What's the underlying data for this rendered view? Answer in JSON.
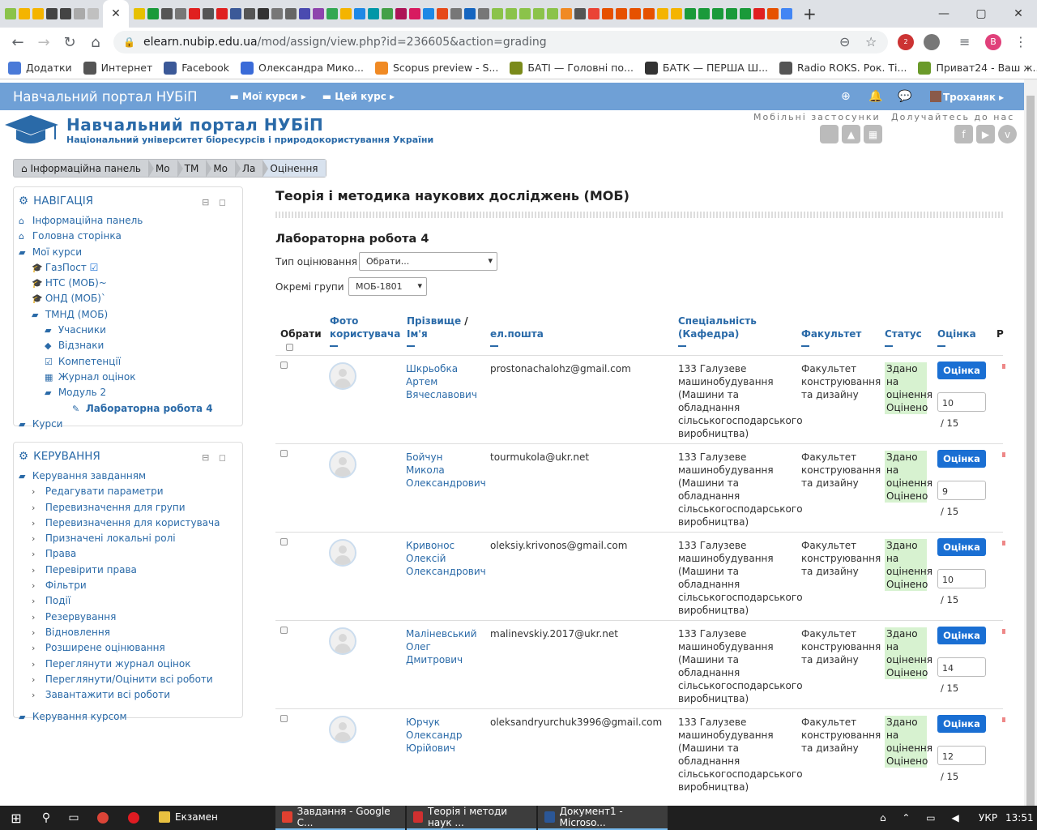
{
  "browser": {
    "active_tab_close": "✕",
    "new_tab": "+",
    "window_controls": {
      "min": "—",
      "max": "▢",
      "close": "✕"
    },
    "url_host": "elearn.nubip.edu.ua",
    "url_path": "/mod/assign/view.php?id=236605&action=grading",
    "profile_initial": "B",
    "ext_badge": "2"
  },
  "bookmarks": [
    {
      "label": "Додатки",
      "color": "#4a7ad8"
    },
    {
      "label": "Интернет",
      "color": "#555"
    },
    {
      "label": "Facebook",
      "color": "#3b5998"
    },
    {
      "label": "Олександра Мико...",
      "color": "#3a6bd8"
    },
    {
      "label": "Scopus preview - S...",
      "color": "#f08a24"
    },
    {
      "label": "БАТІ — Головні по...",
      "color": "#7a8a1a"
    },
    {
      "label": "БАТК — ПЕРША Ш...",
      "color": "#333"
    },
    {
      "label": "Radio ROKS. Рок. Ті...",
      "color": "#555"
    },
    {
      "label": "Приват24 - Ваш ж...",
      "color": "#6a9a2a"
    }
  ],
  "site": {
    "brand": "Навчальний портал НУБіП",
    "menu_my_courses": "Мої курси",
    "menu_this_course": "Цей курс",
    "user": "Троханяк",
    "header_title": "Навчальний портал НУБіП",
    "header_subtitle": "Національний університет біоресурсів і природокористування України",
    "mobile_apps": "Мобільні застосунки",
    "join_us": "Долучайтесь до нас"
  },
  "breadcrumb": [
    "Інформаційна панель",
    "Мо",
    "ТМ",
    "Мо",
    "Ла",
    "Оцінення"
  ],
  "nav_block": {
    "title": "НАВІГАЦІЯ",
    "items": [
      {
        "label": "Інформаційна панель",
        "icon": "⌂",
        "indent": 0
      },
      {
        "label": "Головна сторінка",
        "icon": "⌂",
        "indent": 0
      },
      {
        "label": "Мої курси",
        "icon": "▰",
        "indent": 0
      },
      {
        "label": "ГазПост",
        "icon": "🎓",
        "indent": 1
      },
      {
        "label": "НТС (МОБ)~",
        "icon": "🎓",
        "indent": 1
      },
      {
        "label": "ОНД (МОБ)`",
        "icon": "🎓",
        "indent": 1
      },
      {
        "label": "ТМНД (МОБ)",
        "icon": "▰",
        "indent": 1
      },
      {
        "label": "Учасники",
        "icon": "▰",
        "indent": 2
      },
      {
        "label": "Відзнаки",
        "icon": "◆",
        "indent": 2
      },
      {
        "label": "Компетенції",
        "icon": "☑",
        "indent": 2
      },
      {
        "label": "Журнал оцінок",
        "icon": "▦",
        "indent": 2
      },
      {
        "label": "Модуль 2",
        "icon": "▰",
        "indent": 2
      },
      {
        "label": "Лабораторна робота 4",
        "icon": "✎",
        "indent": 3,
        "current": true
      },
      {
        "label": "Курси",
        "icon": "▰",
        "indent": 0
      }
    ]
  },
  "admin_block": {
    "title": "КЕРУВАННЯ",
    "items": [
      {
        "label": "Керування завданням",
        "icon": "▰",
        "indent": 0
      },
      {
        "label": "Редагувати параметри",
        "icon": "›",
        "indent": 1
      },
      {
        "label": "Перевизначення для групи",
        "icon": "›",
        "indent": 1
      },
      {
        "label": "Перевизначення для користувача",
        "icon": "›",
        "indent": 1
      },
      {
        "label": "Призначені локальні ролі",
        "icon": "›",
        "indent": 1
      },
      {
        "label": "Права",
        "icon": "›",
        "indent": 1
      },
      {
        "label": "Перевірити права",
        "icon": "›",
        "indent": 1
      },
      {
        "label": "Фільтри",
        "icon": "›",
        "indent": 1
      },
      {
        "label": "Події",
        "icon": "›",
        "indent": 1
      },
      {
        "label": "Резервування",
        "icon": "›",
        "indent": 1
      },
      {
        "label": "Відновлення",
        "icon": "›",
        "indent": 1
      },
      {
        "label": "Розширене оцінювання",
        "icon": "›",
        "indent": 1
      },
      {
        "label": "Переглянути журнал оцінок",
        "icon": "›",
        "indent": 1
      },
      {
        "label": "Переглянути/Оцінити всі роботи",
        "icon": "›",
        "indent": 1
      },
      {
        "label": "Завантажити всі роботи",
        "icon": "›",
        "indent": 1
      },
      {
        "label": "Керування курсом",
        "icon": "▰",
        "indent": 0,
        "gap": true
      }
    ]
  },
  "main": {
    "course_title": "Теорія і методика наукових досліджень (МОБ)",
    "assignment_title": "Лабораторна робота 4",
    "grading_type_label": "Тип оцінювання",
    "grading_type_value": "Обрати...",
    "groups_label": "Окремі групи",
    "groups_value": "МОБ-1801"
  },
  "table": {
    "headers": {
      "select": "Обрати",
      "photo": "Фото користувача",
      "name_a": "Прізвище",
      "name_sep": " / ",
      "name_b": "Ім'я",
      "email": "ел.пошта",
      "specialty": "Спеціальність (Кафедра)",
      "faculty": "Факультет",
      "status": "Статус",
      "grade": "Оцінка",
      "more": "Р"
    },
    "rows": [
      {
        "name": "Шкрьобка Артем Вячеславович",
        "email": "prostonachalohz@gmail.com",
        "grade": "10"
      },
      {
        "name": "Бойчун Микола Олександрович",
        "email": "tourmukola@ukr.net",
        "grade": "9"
      },
      {
        "name": "Кривонос Олексій Олександрович",
        "email": "oleksiy.krivonos@gmail.com",
        "grade": "10"
      },
      {
        "name": "Маліневський Олег Дмитрович",
        "email": "malinevskiy.2017@ukr.net",
        "grade": "14"
      },
      {
        "name": "Юрчук Олександр Юрійович",
        "email": "oleksandryurchuk3996@gmail.com",
        "grade": "12"
      }
    ],
    "specialty": "133 Галузеве машинобудування (Машини та обладнання сільськогосподарського виробництва)",
    "faculty": "Факультет конструювання та дизайну",
    "status": "Здано на оцінення Оцінено",
    "grade_button": "Оцінка",
    "grade_max": "/ 15"
  },
  "taskbar": {
    "items": [
      {
        "label": "Екзамен",
        "color": "#e8c040"
      },
      {
        "label": "Завдання - Google C...",
        "color": "#e04030",
        "active": true
      },
      {
        "label": "Теорія і методи наук ...",
        "color": "#d03030",
        "active": true
      },
      {
        "label": "Документ1 - Microso...",
        "color": "#2b5797",
        "active": true
      }
    ],
    "lang": "УКР",
    "time": "13:51"
  }
}
